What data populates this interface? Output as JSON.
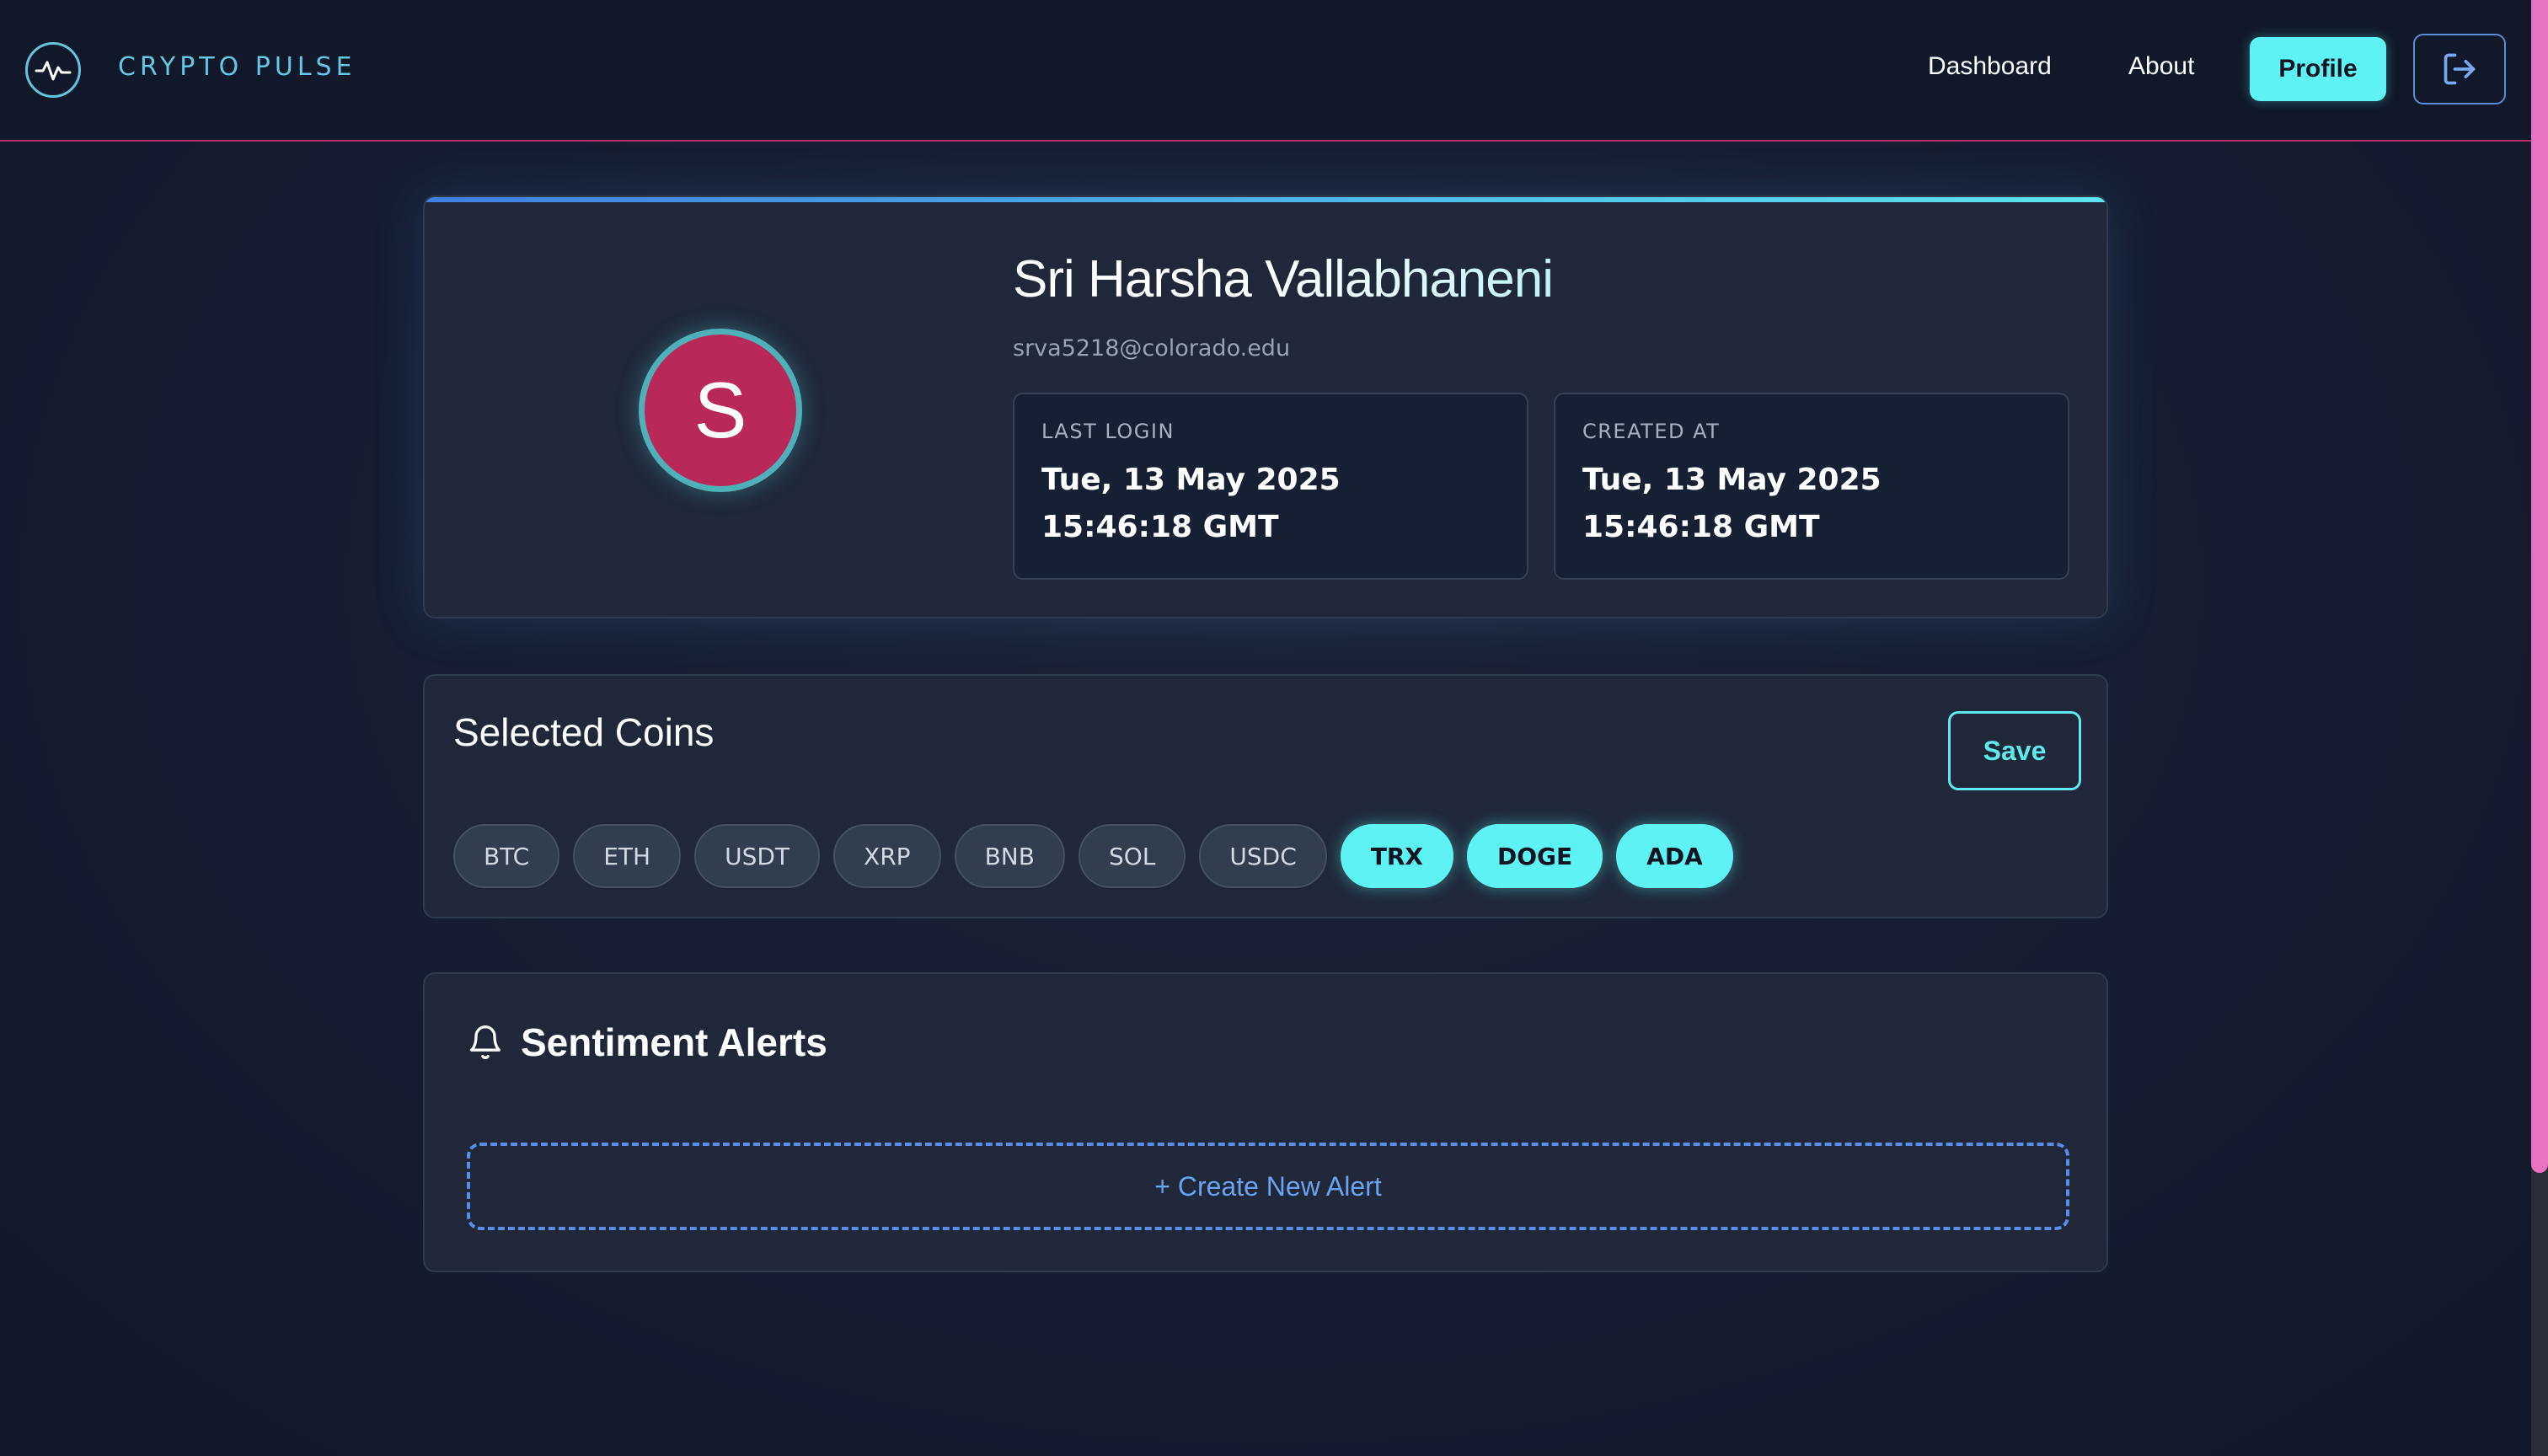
{
  "header": {
    "brand": "CRYPTO PULSE",
    "nav": {
      "dashboard": "Dashboard",
      "about": "About",
      "profile": "Profile"
    },
    "logo_icon": "pulse-icon",
    "logout_icon": "logout-icon"
  },
  "profile": {
    "avatar_initial": "S",
    "name": "Sri Harsha Vallabhaneni",
    "email": "srva5218@colorado.edu",
    "last_login": {
      "label": "LAST LOGIN",
      "value": "Tue, 13 May 2025 15:46:18 GMT"
    },
    "created_at": {
      "label": "CREATED AT",
      "value": "Tue, 13 May 2025 15:46:18 GMT"
    }
  },
  "coins": {
    "title": "Selected Coins",
    "save_label": "Save",
    "items": [
      {
        "symbol": "BTC",
        "selected": false
      },
      {
        "symbol": "ETH",
        "selected": false
      },
      {
        "symbol": "USDT",
        "selected": false
      },
      {
        "symbol": "XRP",
        "selected": false
      },
      {
        "symbol": "BNB",
        "selected": false
      },
      {
        "symbol": "SOL",
        "selected": false
      },
      {
        "symbol": "USDC",
        "selected": false
      },
      {
        "symbol": "TRX",
        "selected": true
      },
      {
        "symbol": "DOGE",
        "selected": true
      },
      {
        "symbol": "ADA",
        "selected": true
      }
    ]
  },
  "alerts": {
    "title": "Sentiment Alerts",
    "icon": "bell-icon",
    "create_label": "+ Create New Alert"
  },
  "colors": {
    "accent": "#5ef2f4",
    "avatar": "#b8295a",
    "header_border": "#b0356c",
    "scrollbar_thumb": "#e773c1"
  }
}
